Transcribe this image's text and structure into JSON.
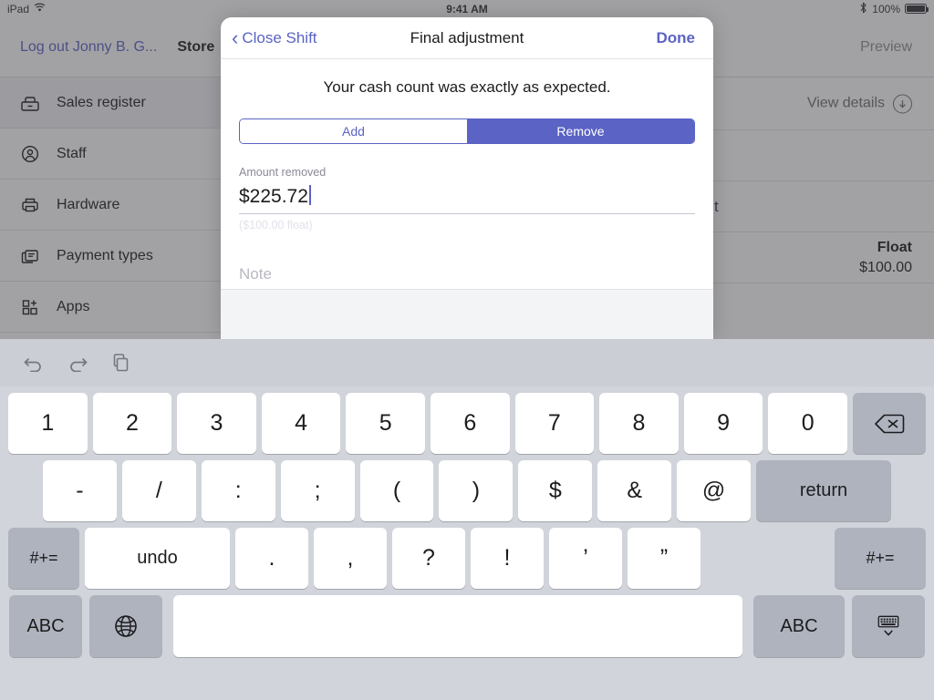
{
  "status_bar": {
    "device": "iPad",
    "wifi_icon": "wifi-icon",
    "time": "9:41 AM",
    "bluetooth_icon": "bluetooth-icon",
    "battery_percent": "100%",
    "battery_icon": "battery-full-icon"
  },
  "app_topbar": {
    "logout_label": "Log out Jonny B. G...",
    "store_label": "Store",
    "preview_label": "Preview"
  },
  "sidebar": {
    "items": [
      {
        "label": "Sales register",
        "icon": "register-drawer-icon",
        "selected": true
      },
      {
        "label": "Staff",
        "icon": "person-circle-icon",
        "selected": false
      },
      {
        "label": "Hardware",
        "icon": "printer-icon",
        "selected": false
      },
      {
        "label": "Payment types",
        "icon": "cards-stack-icon",
        "selected": false
      },
      {
        "label": "Apps",
        "icon": "apps-add-icon",
        "selected": false
      }
    ]
  },
  "content": {
    "view_details_label": "View details",
    "view_details_icon": "circle-arrow-down-icon",
    "partial_text": "t",
    "float_label": "Float",
    "float_value": "$100.00"
  },
  "modal": {
    "back_label": "Close Shift",
    "back_icon": "chevron-left-icon",
    "title": "Final adjustment",
    "done_label": "Done",
    "message": "Your cash count was exactly as expected.",
    "segmented": {
      "options": [
        {
          "label": "Add",
          "active": false
        },
        {
          "label": "Remove",
          "active": true
        }
      ]
    },
    "amount_field": {
      "label": "Amount removed",
      "value": "$225.72",
      "hint": "($100.00 float)"
    },
    "note_field": {
      "placeholder": "Note",
      "value": ""
    }
  },
  "keyboard": {
    "toolbar": [
      {
        "icon": "undo-icon"
      },
      {
        "icon": "redo-icon"
      },
      {
        "icon": "paste-icon"
      }
    ],
    "row1": [
      {
        "label": "1"
      },
      {
        "label": "2"
      },
      {
        "label": "3"
      },
      {
        "label": "4"
      },
      {
        "label": "5"
      },
      {
        "label": "6"
      },
      {
        "label": "7"
      },
      {
        "label": "8"
      },
      {
        "label": "9"
      },
      {
        "label": "0"
      }
    ],
    "backspace_icon": "backspace-icon",
    "row2": [
      {
        "label": "-"
      },
      {
        "label": "/"
      },
      {
        "label": ":"
      },
      {
        "label": ";"
      },
      {
        "label": "("
      },
      {
        "label": ")"
      },
      {
        "label": "$"
      },
      {
        "label": "&"
      },
      {
        "label": "@"
      }
    ],
    "return_label": "return",
    "row3": {
      "left_shift_label": "#+=",
      "undo_label": "undo",
      "keys": [
        {
          "label": "."
        },
        {
          "label": ","
        },
        {
          "label": "?"
        },
        {
          "label": "!"
        },
        {
          "label": "’"
        },
        {
          "label": "”"
        }
      ],
      "right_shift_label": "#+="
    },
    "row4": {
      "abc_left_label": "ABC",
      "globe_icon": "globe-icon",
      "space_label": "",
      "abc_right_label": "ABC",
      "dismiss_icon": "keyboard-dismiss-icon"
    }
  },
  "colors": {
    "accent": "#5b63c4",
    "key_white": "#ffffff",
    "key_dark": "#aeb3be",
    "keyboard_bg": "#d1d4da"
  }
}
